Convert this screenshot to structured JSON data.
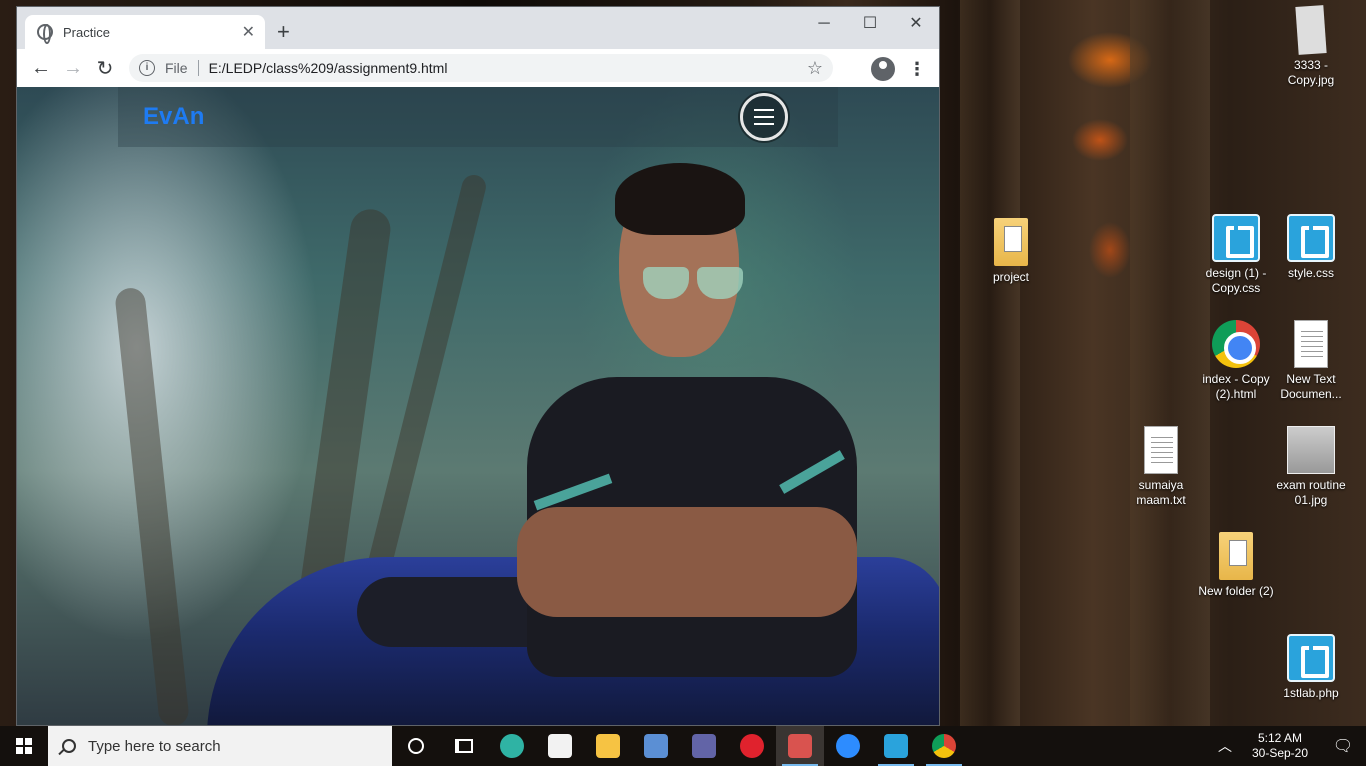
{
  "browser": {
    "tab": {
      "title": "Practice",
      "close": "✕"
    },
    "newtab": "+",
    "window_controls": {
      "minimize": "─",
      "maximize": "☐",
      "close": "✕"
    },
    "nav": {
      "back": "←",
      "forward": "→",
      "reload": "↻"
    },
    "omnibox": {
      "info": "i",
      "scheme": "File",
      "url": "E:/LEDP/class%209/assignment9.html",
      "star": "☆"
    },
    "menu": "⋮"
  },
  "page": {
    "brand": "EvAn",
    "menu_icon": "hamburger-icon"
  },
  "desktop_icons": [
    {
      "label": "3333 - Copy.jpg",
      "icon": "image-file-icon"
    },
    {
      "label": "project",
      "icon": "folder-icon"
    },
    {
      "label": "design (1) - Copy.css",
      "icon": "brackets-file-icon"
    },
    {
      "label": "style.css",
      "icon": "brackets-file-icon"
    },
    {
      "label": "index - Copy (2).html",
      "icon": "chrome-file-icon"
    },
    {
      "label": "New Text Documen...",
      "icon": "text-file-icon"
    },
    {
      "label": "sumaiya maam.txt",
      "icon": "text-file-icon"
    },
    {
      "label": "exam routine 01.jpg",
      "icon": "image-file-icon"
    },
    {
      "label": "New folder (2)",
      "icon": "folder-icon"
    },
    {
      "label": "1stlab.php",
      "icon": "brackets-file-icon"
    }
  ],
  "taskbar": {
    "search_placeholder": "Type here to search",
    "apps": [
      {
        "name": "cortana",
        "color": "#ffffff"
      },
      {
        "name": "task-view",
        "color": "#ffffff"
      },
      {
        "name": "edge",
        "color": "#2fb3a4"
      },
      {
        "name": "store",
        "color": "#f2f2f2"
      },
      {
        "name": "file-explorer",
        "color": "#f6c343"
      },
      {
        "name": "remote-desktop",
        "color": "#5b8fd4"
      },
      {
        "name": "teams",
        "color": "#6264a7"
      },
      {
        "name": "opera",
        "color": "#e0222d"
      },
      {
        "name": "snipping-tool",
        "color": "#d9534f"
      },
      {
        "name": "zoom",
        "color": "#2d8cff"
      },
      {
        "name": "brackets",
        "color": "#2aa3dc"
      },
      {
        "name": "chrome",
        "color": "#4285f4"
      }
    ],
    "time": "5:12 AM",
    "date": "30-Sep-20",
    "tray_chevron": "︿",
    "notifications": "🗨"
  }
}
